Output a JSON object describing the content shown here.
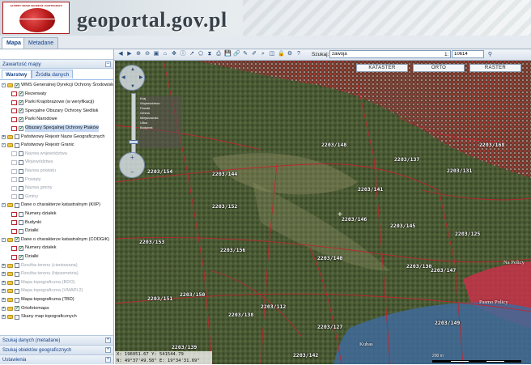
{
  "header": {
    "logo_text": "GŁÓWNY URZĄD GEODEZJI I KARTOGRAFII",
    "site_title": "geoportal.gov.pl"
  },
  "tabs": [
    {
      "label": "Mapa",
      "active": true
    },
    {
      "label": "Metadane",
      "active": false
    }
  ],
  "left_panel": {
    "title": "Zawartość mapy",
    "subtabs": [
      {
        "label": "Warstwy",
        "active": true
      },
      {
        "label": "Źródła danych",
        "active": false
      }
    ],
    "layers": [
      {
        "label": "WMS Generalnej Dyrekcji Ochrony Środowiska",
        "level": 0,
        "expanded": true,
        "checked": true,
        "folder": true
      },
      {
        "label": "Rezerwaty",
        "level": 1,
        "checked": true
      },
      {
        "label": "Parki Krajobrazowe (w weryfikacji)",
        "level": 1,
        "checked": true
      },
      {
        "label": "Specjalne Obszary Ochrony Siedlisk",
        "level": 1,
        "checked": true
      },
      {
        "label": "Parki Narodowe",
        "level": 1,
        "checked": true
      },
      {
        "label": "Obszary Specjalnej Ochrony Ptaków",
        "level": 1,
        "checked": true,
        "highlighted": true
      },
      {
        "label": "Państwowy Rejestr Nazw Geograficznych",
        "level": 0,
        "expanded": false,
        "checked": false,
        "folder": true
      },
      {
        "label": "Państwowy Rejestr Granic",
        "level": 0,
        "expanded": true,
        "checked": false,
        "folder": true
      },
      {
        "label": "Nazwa województwa",
        "level": 1,
        "checked": false,
        "disabled": true
      },
      {
        "label": "Województwa",
        "level": 1,
        "checked": false,
        "disabled": true
      },
      {
        "label": "Nazwa powiatu",
        "level": 1,
        "checked": false,
        "disabled": true
      },
      {
        "label": "Powiaty",
        "level": 1,
        "checked": false,
        "disabled": true
      },
      {
        "label": "Nazwa gminy",
        "level": 1,
        "checked": false,
        "disabled": true
      },
      {
        "label": "Gminy",
        "level": 1,
        "checked": false,
        "disabled": true
      },
      {
        "label": "Dane o charakterze katastralnym (KIIP)",
        "level": 0,
        "expanded": true,
        "checked": false,
        "folder": true
      },
      {
        "label": "Numery działek",
        "level": 1,
        "checked": false
      },
      {
        "label": "Budynki",
        "level": 1,
        "checked": false
      },
      {
        "label": "Działki",
        "level": 1,
        "checked": false
      },
      {
        "label": "Dane o charakterze katastralnym (CODGiK)",
        "level": 0,
        "expanded": true,
        "checked": true,
        "folder": true
      },
      {
        "label": "Numery działek",
        "level": 1,
        "checked": true
      },
      {
        "label": "Działki",
        "level": 1,
        "checked": true
      },
      {
        "label": "Rzeźba terenu (cieniowana)",
        "level": 0,
        "expanded": false,
        "checked": false,
        "folder": true,
        "disabled": true
      },
      {
        "label": "Rzeźba terenu (hipsometria)",
        "level": 0,
        "expanded": false,
        "checked": false,
        "folder": true,
        "disabled": true
      },
      {
        "label": "Mapa topograficzna (BDO)",
        "level": 0,
        "expanded": false,
        "checked": false,
        "folder": true,
        "disabled": true
      },
      {
        "label": "Mapa topograficzna (VMAPL2)",
        "level": 0,
        "expanded": false,
        "checked": false,
        "folder": true,
        "disabled": true
      },
      {
        "label": "Mapa topograficzna (TBD)",
        "level": 0,
        "expanded": false,
        "checked": false,
        "folder": true
      },
      {
        "label": "Ortofotomapa",
        "level": 0,
        "expanded": false,
        "checked": true,
        "folder": true
      },
      {
        "label": "Skany map topograficznych",
        "level": 0,
        "expanded": false,
        "checked": false,
        "folder": true
      }
    ],
    "bottom_panels": [
      {
        "label": "Szukaj danych (metadane)"
      },
      {
        "label": "Szukaj obiektów geograficznych"
      },
      {
        "label": "Ustawienia"
      }
    ]
  },
  "toolbar": {
    "icons": [
      "arrow-left-icon",
      "arrow-right-icon",
      "zoom-in-icon",
      "zoom-out-icon",
      "zoom-box-icon",
      "full-extent-icon",
      "pan-icon",
      "info-icon",
      "measure-line-icon",
      "measure-area-icon",
      "profile-icon",
      "print-icon",
      "save-map-icon",
      "link-icon",
      "edit-icon",
      "draw-icon",
      "search-map-icon",
      "overview-icon",
      "lock-icon",
      "settings-icon",
      "help-icon"
    ],
    "search_label": "Szukaj:",
    "search_value": "zawoja",
    "scale_label": "1:",
    "scale_value": "10614"
  },
  "map": {
    "basemap_buttons": [
      "KATASTER",
      "ORTO",
      "RASTER"
    ],
    "coords_x": "X: 196051.67",
    "coords_y": "Y: 541544.79",
    "coords_n": "N: 49°37'49.58\"",
    "coords_e": "E: 19°34'31.69\"",
    "scale_text": "200 m",
    "zoom_levels": [
      "Kraj",
      "Województwo",
      "Powiat",
      "Gmina",
      "Miejscowość",
      "Ulica",
      "Budynek"
    ],
    "parcel_labels": [
      "2203/154",
      "2203/144",
      "2203/146",
      "2203/148",
      "2203/137",
      "2203/131",
      "2203/152",
      "2203/153",
      "2203/156",
      "2203/140",
      "2203/145",
      "2203/147",
      "2203/149",
      "2203/150",
      "2203/151",
      "2203/127",
      "2203/125",
      "2203/112",
      "2203/141",
      "2203/168",
      "2203/130",
      "2203/138",
      "2203/139",
      "2203/142"
    ],
    "place_names": [
      "Na Policy",
      "Pasmo Policy",
      "Kubas"
    ],
    "colors": {
      "forest": "#4a5a34",
      "parcel_line": "#b8242c",
      "protected_red": "#c8324a",
      "protected_blue": "#3f6a9a"
    }
  }
}
